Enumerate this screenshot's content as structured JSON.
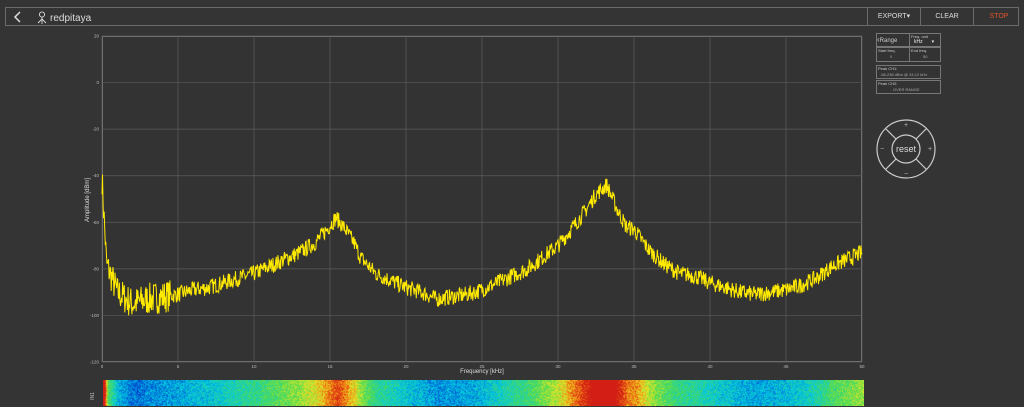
{
  "header": {
    "logo_text": "redpitaya",
    "export_label": "EXPORT",
    "clear_label": "CLEAR",
    "stop_label": "STOP",
    "stop_color": "#e0532b"
  },
  "chart_data": {
    "type": "line",
    "xlabel": "Frequency [kHz]",
    "ylabel": "Amplitude [dBm]",
    "xlim": [
      0,
      50
    ],
    "ylim": [
      -120,
      20
    ],
    "x_ticks": [
      "0",
      "5",
      "10",
      "15",
      "20",
      "25",
      "30",
      "35",
      "40",
      "45",
      "50"
    ],
    "y_ticks": [
      "20",
      "0",
      "-20",
      "-40",
      "-60",
      "-80",
      "-100",
      "-120"
    ],
    "grid": true,
    "series": [
      {
        "color": "#ffea00",
        "x": [
          0,
          0.3,
          1,
          2,
          3,
          4,
          5,
          6,
          7,
          8,
          9,
          10,
          11,
          12,
          13,
          14,
          14.8,
          15.4,
          16,
          16.6,
          17,
          18,
          19,
          20,
          21,
          22,
          23,
          24,
          25,
          26,
          27,
          28,
          29,
          30,
          31,
          31.8,
          32.5,
          33.2,
          34,
          34.5,
          35,
          36,
          37,
          38,
          39,
          40,
          41,
          42,
          43,
          44,
          45,
          46,
          47,
          48,
          49,
          50
        ],
        "y": [
          -41,
          -78,
          -90,
          -95,
          -93,
          -92,
          -91,
          -89,
          -88,
          -86,
          -84,
          -82,
          -79,
          -76,
          -73,
          -69,
          -63,
          -58,
          -63,
          -69,
          -75,
          -82,
          -85,
          -88,
          -90,
          -93,
          -92,
          -91,
          -89,
          -86,
          -83,
          -80,
          -75,
          -70,
          -62,
          -55,
          -48,
          -44,
          -56,
          -62,
          -63,
          -72,
          -78,
          -82,
          -83,
          -86,
          -88,
          -90,
          -91,
          -90,
          -89,
          -87,
          -84,
          -79,
          -76,
          -73
        ]
      }
    ]
  },
  "range_panel": {
    "back_label": "Range",
    "freq_unit_label": "Freq. unit",
    "freq_unit_value": "kHz",
    "start_freq_label": "Start freq.",
    "start_freq_value": "0",
    "end_freq_label": "End freq.",
    "end_freq_value": "50",
    "peak_ch1_label": "Peak CH1:",
    "peak_ch1_value": "-58,238 dBm @ 34,12 kHz",
    "peak_ch2_label": "Peak CH2:",
    "peak_ch2_value": "OVER RANGE"
  },
  "nav_control": {
    "reset_label": "reset",
    "plus_label": "+",
    "minus_label": "−"
  },
  "waterfall": {
    "channel_label": "IN1"
  }
}
